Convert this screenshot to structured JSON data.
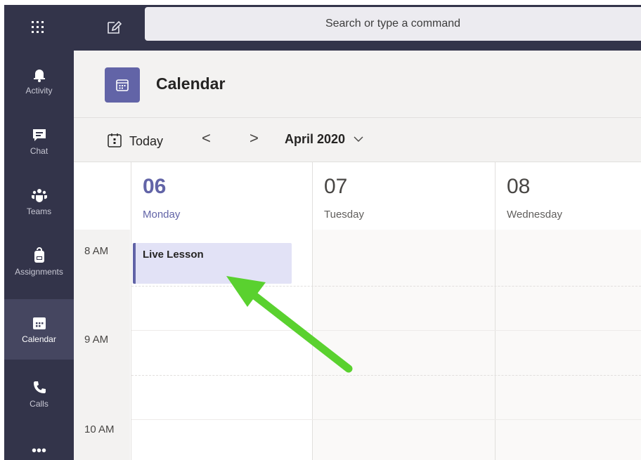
{
  "search": {
    "placeholder": "Search or type a command"
  },
  "rail": {
    "items": [
      {
        "label": "Activity",
        "icon": "bell-icon"
      },
      {
        "label": "Chat",
        "icon": "chat-icon"
      },
      {
        "label": "Teams",
        "icon": "teams-icon"
      },
      {
        "label": "Assignments",
        "icon": "backpack-icon"
      },
      {
        "label": "Calendar",
        "icon": "calendar-icon",
        "active": true
      },
      {
        "label": "Calls",
        "icon": "phone-icon"
      }
    ],
    "more": "•••"
  },
  "header": {
    "title": "Calendar"
  },
  "toolbar": {
    "today_label": "Today",
    "prev": "<",
    "next": ">",
    "month": "April 2020"
  },
  "days": [
    {
      "num": "06",
      "name": "Monday",
      "today": true
    },
    {
      "num": "07",
      "name": "Tuesday"
    },
    {
      "num": "08",
      "name": "Wednesday"
    }
  ],
  "times": [
    "8 AM",
    "9 AM",
    "10 AM"
  ],
  "event": {
    "title": "Live Lesson"
  },
  "colors": {
    "rail": "#33344a",
    "accent": "#6264a7",
    "arrow": "#5ad12f"
  }
}
